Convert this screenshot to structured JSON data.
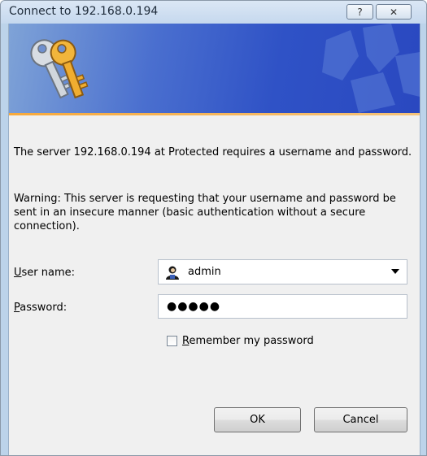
{
  "window": {
    "title": "Connect to 192.168.0.194",
    "help_glyph": "?",
    "close_glyph": "✕"
  },
  "banner": {
    "icon": "keys-icon",
    "accent_color": "#f7a93b"
  },
  "message": {
    "line1": "The server 192.168.0.194 at Protected requires a username and password.",
    "warning": "Warning: This server is requesting that your username and password be sent in an insecure manner (basic authentication without a secure connection)."
  },
  "form": {
    "username_label_accel": "U",
    "username_label_rest": "ser name:",
    "username_value": "admin",
    "user_icon": "user-icon",
    "password_label_accel": "P",
    "password_label_rest": "assword:",
    "password_mask": "●●●●●",
    "remember_label_accel": "R",
    "remember_label_rest": "emember my password",
    "remember_checked": false
  },
  "buttons": {
    "ok_label": "OK",
    "cancel_label": "Cancel"
  }
}
